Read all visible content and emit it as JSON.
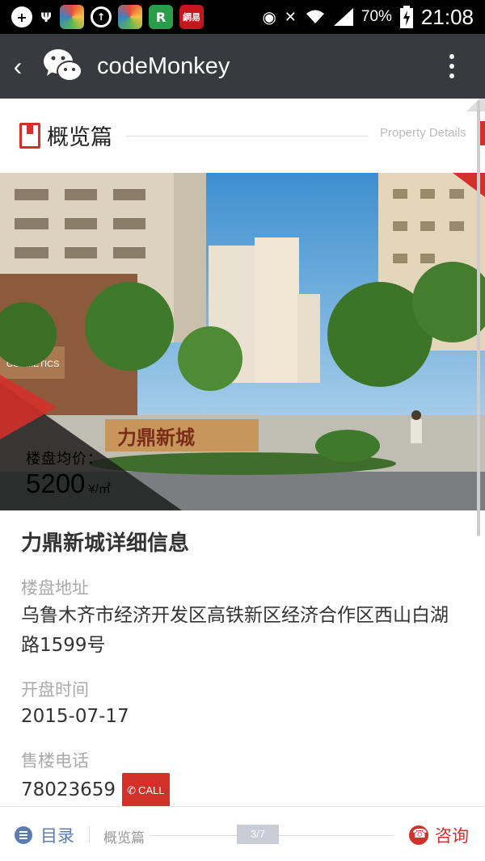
{
  "status_bar": {
    "battery": "70%",
    "time": "21:08",
    "icons": [
      "add-icon",
      "usb-icon",
      "app-icon",
      "sync-icon",
      "app-icon",
      "r-app-icon",
      "netease-icon",
      "eye-icon",
      "mute-icon",
      "wifi-icon",
      "signal-icon",
      "battery-charging-icon"
    ],
    "netease_label": "網易"
  },
  "header": {
    "title": "codeMonkey",
    "back_icon": "chevron-left-icon",
    "logo_icon": "wechat-icon",
    "menu_icon": "more-vertical-icon"
  },
  "section": {
    "title": "概览篇",
    "subtitle": "Property Details"
  },
  "hero": {
    "price_label": "楼盘均价：",
    "price_value": "5200",
    "price_unit": "¥/㎡",
    "sign_text": "力鼎新城",
    "store_text": "COSMETICS"
  },
  "info": {
    "title": "力鼎新城详细信息",
    "address_label": "楼盘地址",
    "address_value": "乌鲁木齐市经济开发区高铁新区经济合作区西山白湖路1599号",
    "open_label": "开盘时间",
    "open_value": "2015-07-17",
    "phone_label": "售楼电话",
    "phone_value": "78023659",
    "call_label": "CALL"
  },
  "bottom": {
    "toc_label": "目录",
    "page_name": "概览篇",
    "page_indicator": "3/7",
    "consult_label": "咨询"
  },
  "colors": {
    "accent": "#d3302a",
    "titlebar": "#393a3f",
    "toc_blue": "#5c7bb3"
  }
}
